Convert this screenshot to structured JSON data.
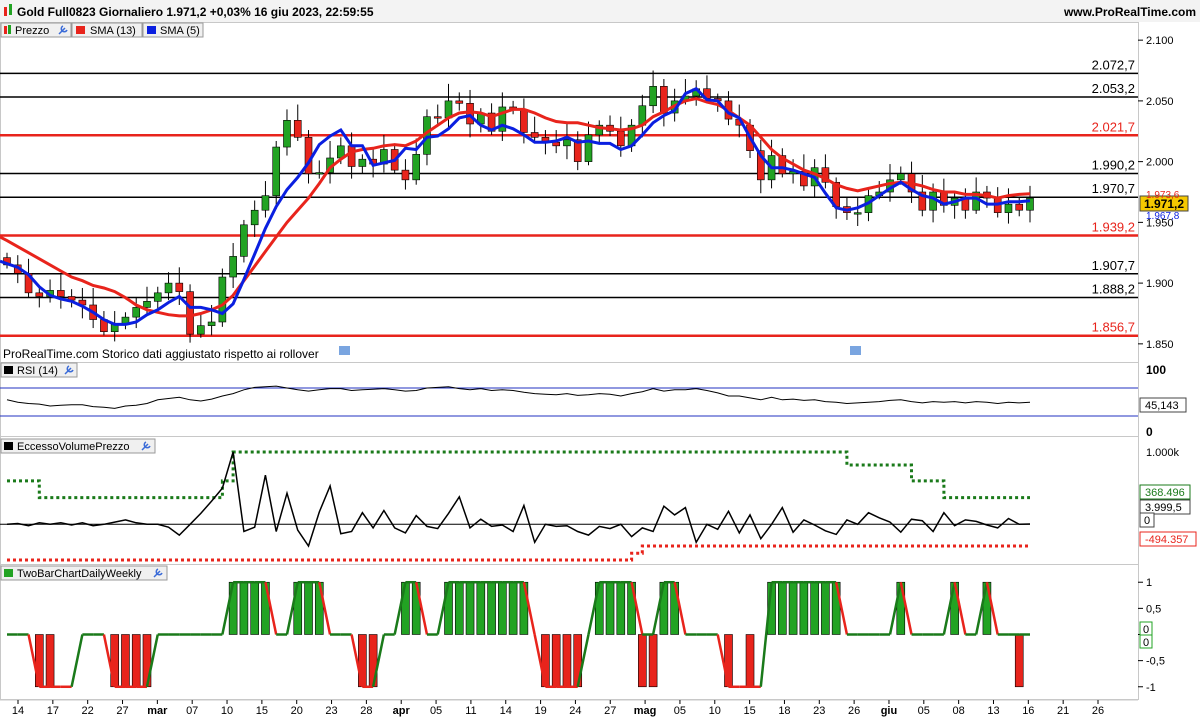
{
  "header": {
    "title": "Gold Full0823 Giornaliero 1.971,2 +0,03% 16 giu 2023, 22:59:55",
    "site": "www.ProRealTime.com"
  },
  "price_panel": {
    "legend": [
      "Prezzo",
      "SMA (13)",
      "SMA (5)"
    ],
    "watermark": "ProRealTime.com Storico dati aggiustato rispetto ai rollover",
    "last_price": "1.971,2",
    "sma13_value": "1.973,6",
    "sma5_value": "1.967,8"
  },
  "rsi_panel": {
    "title": "RSI (14)",
    "value_label": "45,143",
    "top_label": "100",
    "bottom_label": "0"
  },
  "volume_panel": {
    "title": "EccessoVolumePrezzo",
    "upper_label": "368.496",
    "mid_label": "3.999,5",
    "zero_label": "0",
    "lower_label": "-494.357"
  },
  "twobar_panel": {
    "title": "TwoBarChartDailyWeekly",
    "label_a": "0",
    "label_b": "0"
  },
  "colors": {
    "up": "#22a323",
    "down": "#e8241c",
    "sma13": "#e8241c",
    "sma5": "#0a1fe0",
    "highlight": "#f5c800"
  },
  "chart_data": [
    {
      "type": "candlestick",
      "title": "Gold Full0823 Giornaliero",
      "x_ticks": [
        "14",
        "17",
        "22",
        "27",
        "mar",
        "07",
        "10",
        "15",
        "20",
        "23",
        "28",
        "apr",
        "05",
        "11",
        "14",
        "19",
        "24",
        "27",
        "mag",
        "05",
        "10",
        "15",
        "18",
        "23",
        "26",
        "giu",
        "05",
        "08",
        "13",
        "16",
        "21",
        "26"
      ],
      "y_ticks": [
        "1.850",
        "1.900",
        "1.950",
        "2.000",
        "2.050",
        "2.100"
      ],
      "ylim": [
        1840,
        2110
      ],
      "levels": [
        {
          "label": "2.072,7",
          "value": 2072.7,
          "color": "black"
        },
        {
          "label": "2.053,2",
          "value": 2053.2,
          "color": "black"
        },
        {
          "label": "2.021,7",
          "value": 2021.7,
          "color": "red"
        },
        {
          "label": "1.990,2",
          "value": 1990.2,
          "color": "black"
        },
        {
          "label": "1.970,7",
          "value": 1970.7,
          "color": "black"
        },
        {
          "label": "1.939,2",
          "value": 1939.2,
          "color": "red"
        },
        {
          "label": "1.907,7",
          "value": 1907.7,
          "color": "black"
        },
        {
          "label": "1.888,2",
          "value": 1888.2,
          "color": "black"
        },
        {
          "label": "1.856,7",
          "value": 1856.7,
          "color": "red"
        }
      ],
      "close": [
        1915,
        1908,
        1892,
        1889,
        1894,
        1889,
        1886,
        1882,
        1870,
        1860,
        1866,
        1872,
        1880,
        1885,
        1892,
        1900,
        1893,
        1858,
        1865,
        1868,
        1905,
        1922,
        1948,
        1960,
        1972,
        2012,
        2034,
        2020,
        1990,
        1991,
        2003,
        2013,
        1996,
        2002,
        1998,
        2010,
        1993,
        1985,
        2006,
        2037,
        2036,
        2050,
        2048,
        2031,
        2040,
        2025,
        2045,
        2043,
        2024,
        2020,
        2016,
        2013,
        2018,
        2000,
        2022,
        2030,
        2025,
        2013,
        2030,
        2046,
        2062,
        2040,
        2050,
        2054,
        2060,
        2052,
        2050,
        2035,
        2030,
        2009,
        1985,
        2005,
        1990,
        1992,
        1980,
        1995,
        1983,
        1963,
        1958,
        1958,
        1972,
        1975,
        1985,
        1990,
        1975,
        1960,
        1975,
        1964,
        1970,
        1960,
        1975,
        1970,
        1958,
        1965,
        1960,
        1970
      ],
      "sma13": [
        1935,
        1930,
        1925,
        1920,
        1915,
        1910,
        1905,
        1902,
        1898,
        1896,
        1893,
        1888,
        1882,
        1878,
        1876,
        1874,
        1873,
        1873,
        1875,
        1878,
        1882,
        1890,
        1902,
        1914,
        1926,
        1938,
        1950,
        1960,
        1970,
        1982,
        1995,
        2002,
        2008,
        2010,
        2011,
        2013,
        2014,
        2013,
        2017,
        2024,
        2030,
        2036,
        2040,
        2041,
        2040,
        2037,
        2040,
        2043,
        2043,
        2040,
        2036,
        2033,
        2032,
        2032,
        2030,
        2028,
        2027,
        2026,
        2027,
        2030,
        2037,
        2041,
        2046,
        2050,
        2052,
        2049,
        2047,
        2042,
        2036,
        2030,
        2020,
        2010,
        2003,
        1998,
        1993,
        1990,
        1986,
        1981,
        1978,
        1976,
        1978,
        1980,
        1982,
        1983,
        1982,
        1980,
        1977,
        1975,
        1975,
        1973,
        1973,
        1972,
        1970,
        1972,
        1973,
        1973.6
      ],
      "sma5": [
        1916,
        1913,
        1907,
        1897,
        1890,
        1887,
        1885,
        1881,
        1876,
        1870,
        1866,
        1866,
        1868,
        1874,
        1878,
        1884,
        1889,
        1880,
        1880,
        1878,
        1875,
        1883,
        1903,
        1924,
        1945,
        1963,
        1977,
        1987,
        1999,
        2014,
        2021,
        2026,
        2013,
        2013,
        1997,
        1999,
        2001,
        2011,
        2010,
        2020,
        2021,
        2027,
        2036,
        2038,
        2030,
        2026,
        2030,
        2027,
        2022,
        2016,
        2016,
        2017,
        2020,
        2016,
        2017,
        2015,
        2015,
        2010,
        2013,
        2022,
        2032,
        2038,
        2042,
        2056,
        2060,
        2051,
        2050,
        2040,
        2036,
        2020,
        2005,
        1995,
        1995,
        1993,
        1990,
        1987,
        1974,
        1962,
        1960,
        1962,
        1966,
        1972,
        1978,
        1983,
        1977,
        1972,
        1970,
        1965,
        1967,
        1970,
        1970,
        1965,
        1965,
        1967,
        1967,
        1967.8
      ]
    },
    {
      "type": "line",
      "title": "RSI (14)",
      "ylim": [
        0,
        100
      ],
      "values": [
        52,
        48,
        46,
        45,
        42,
        43,
        44,
        44,
        41,
        40,
        38,
        42,
        43,
        46,
        52,
        54,
        56,
        52,
        50,
        53,
        58,
        62,
        68,
        72,
        73,
        74,
        71,
        68,
        66,
        68,
        70,
        70,
        67,
        68,
        69,
        70,
        68,
        66,
        67,
        71,
        72,
        73,
        70,
        68,
        70,
        67,
        68,
        67,
        64,
        62,
        61,
        60,
        62,
        59,
        60,
        62,
        61,
        58,
        62,
        65,
        70,
        66,
        68,
        68,
        70,
        67,
        63,
        58,
        58,
        55,
        52,
        56,
        52,
        53,
        51,
        52,
        49,
        48,
        46,
        47,
        48,
        49,
        51,
        52,
        49,
        47,
        49,
        48,
        49,
        47,
        49,
        48,
        46,
        48,
        47,
        48
      ]
    },
    {
      "type": "line",
      "title": "EccessoVolumePrezzo",
      "ylim": [
        -494357,
        1000000
      ],
      "values": [
        0,
        10000,
        -20000,
        20000,
        0,
        20000,
        -10000,
        20000,
        -20000,
        0,
        30000,
        60000,
        20000,
        0,
        0,
        -40000,
        -150000,
        0,
        150000,
        320000,
        500000,
        1000000,
        -100000,
        -40000,
        680000,
        -100000,
        430000,
        -80000,
        -300000,
        170000,
        530000,
        -130000,
        -100000,
        160000,
        -50000,
        190000,
        -50000,
        -120000,
        120000,
        -30000,
        -60000,
        150000,
        380000,
        -50000,
        70000,
        -30000,
        -10000,
        -100000,
        260000,
        -250000,
        0,
        -30000,
        -20000,
        -100000,
        -150000,
        -30000,
        -60000,
        0,
        -170000,
        -50000,
        -100000,
        250000,
        130000,
        230000,
        -250000,
        0,
        -70000,
        180000,
        -120000,
        130000,
        -200000,
        0,
        230000,
        -110000,
        60000,
        -10000,
        -90000,
        -140000,
        60000,
        0,
        160000,
        90000,
        30000,
        -110000,
        70000,
        50000,
        -100000,
        160000,
        -20000,
        60000,
        40000,
        -10000,
        -50000,
        80000,
        0,
        4000
      ],
      "upper_band": [
        600000,
        600000,
        600000,
        368496,
        368496,
        368496,
        368496,
        368496,
        368496,
        368496,
        368496,
        368496,
        368496,
        368496,
        368496,
        368496,
        368496,
        368496,
        368496,
        368496,
        600000,
        1000000,
        1000000,
        1000000,
        1000000,
        1000000,
        1000000,
        1000000,
        1000000,
        1000000,
        1000000,
        1000000,
        1000000,
        1000000,
        1000000,
        1000000,
        1000000,
        1000000,
        1000000,
        1000000,
        1000000,
        1000000,
        1000000,
        1000000,
        1000000,
        1000000,
        1000000,
        1000000,
        1000000,
        1000000,
        1000000,
        1000000,
        1000000,
        1000000,
        1000000,
        1000000,
        1000000,
        1000000,
        1000000,
        1000000,
        1000000,
        1000000,
        1000000,
        1000000,
        1000000,
        1000000,
        1000000,
        1000000,
        1000000,
        1000000,
        1000000,
        1000000,
        1000000,
        1000000,
        1000000,
        1000000,
        1000000,
        1000000,
        820000,
        820000,
        820000,
        820000,
        820000,
        820000,
        600000,
        600000,
        600000,
        368496,
        368496,
        368496,
        368496,
        368496,
        368496,
        368496,
        368496,
        368496
      ],
      "lower_band": [
        -494357,
        -494357,
        -494357,
        -494357,
        -494357,
        -494357,
        -494357,
        -494357,
        -494357,
        -494357,
        -494357,
        -494357,
        -494357,
        -494357,
        -494357,
        -494357,
        -494357,
        -494357,
        -494357,
        -494357,
        -494357,
        -494357,
        -494357,
        -494357,
        -494357,
        -494357,
        -494357,
        -494357,
        -494357,
        -494357,
        -494357,
        -494357,
        -494357,
        -494357,
        -494357,
        -494357,
        -494357,
        -494357,
        -494357,
        -494357,
        -494357,
        -494357,
        -494357,
        -494357,
        -494357,
        -494357,
        -494357,
        -494357,
        -494357,
        -494357,
        -494357,
        -494357,
        -494357,
        -494357,
        -494357,
        -494357,
        -494357,
        -494357,
        -400000,
        -300000,
        -300000,
        -300000,
        -300000,
        -300000,
        -300000,
        -300000,
        -300000,
        -300000,
        -300000,
        -300000,
        -300000,
        -300000,
        -300000,
        -300000,
        -300000,
        -300000,
        -300000,
        -300000,
        -300000,
        -300000,
        -300000,
        -300000,
        -300000,
        -300000,
        -300000,
        -300000,
        -300000,
        -300000,
        -300000,
        -300000,
        -300000,
        -300000,
        -300000,
        -300000,
        -300000,
        -300000
      ]
    },
    {
      "type": "bar",
      "title": "TwoBarChartDailyWeekly",
      "y_ticks": [
        "1",
        "0,5",
        "0",
        "-0,5",
        "-1"
      ],
      "ylim": [
        -1.1,
        1.1
      ],
      "bars": [
        0,
        0,
        0,
        -1,
        -1,
        0,
        0,
        0,
        0,
        0,
        -1,
        -1,
        -1,
        -1,
        0,
        0,
        0,
        0,
        0,
        0,
        0,
        1,
        1,
        1,
        1,
        0,
        0,
        1,
        1,
        1,
        0,
        0,
        0,
        -1,
        -1,
        0,
        0,
        1,
        1,
        0,
        0,
        1,
        1,
        1,
        1,
        1,
        1,
        1,
        1,
        0,
        -1,
        -1,
        -1,
        -1,
        0,
        1,
        1,
        1,
        1,
        -1,
        -1,
        1,
        1,
        0,
        0,
        0,
        0,
        -1,
        0,
        -1,
        0,
        1,
        1,
        1,
        1,
        1,
        1,
        1,
        0,
        0,
        0,
        0,
        0,
        1,
        0,
        0,
        0,
        0,
        1,
        0,
        0,
        1,
        0,
        0,
        -1,
        0
      ],
      "signal": [
        0,
        0,
        0,
        -1,
        -1,
        -1,
        -1,
        0,
        0,
        0,
        -1,
        -1,
        -1,
        -1,
        0,
        0,
        0,
        0,
        0,
        0,
        0,
        1,
        1,
        1,
        1,
        0,
        0,
        1,
        1,
        1,
        0,
        0,
        0,
        -1,
        -1,
        0,
        0,
        1,
        1,
        0,
        0,
        1,
        1,
        1,
        1,
        1,
        1,
        1,
        1,
        0,
        -1,
        -1,
        -1,
        -1,
        0,
        1,
        1,
        1,
        1,
        0,
        0,
        1,
        1,
        0,
        0,
        0,
        0,
        -1,
        -1,
        -1,
        -1,
        1,
        1,
        1,
        1,
        1,
        1,
        1,
        0,
        0,
        0,
        0,
        0,
        1,
        0,
        0,
        0,
        0,
        1,
        0,
        0,
        1,
        0,
        0,
        0,
        0
      ]
    }
  ]
}
